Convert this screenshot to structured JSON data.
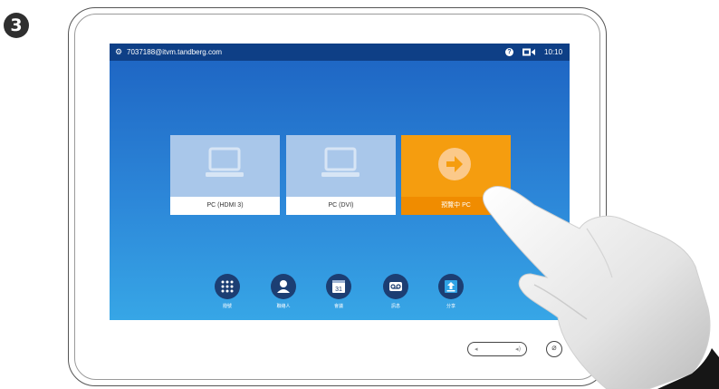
{
  "step": {
    "number": "3"
  },
  "topbar": {
    "address": "7037188@itvm.tandberg.com",
    "help_symbol": "?",
    "time": "10:10",
    "bar_color": "#0e3f86"
  },
  "sources": [
    {
      "label": "PC (HDMI 3)",
      "icon": "laptop-icon",
      "state": "idle"
    },
    {
      "label": "PC (DVI)",
      "icon": "laptop-icon",
      "state": "idle"
    },
    {
      "label": "預覽中 PC",
      "icon": "arrow-right-circle-icon",
      "state": "active"
    }
  ],
  "dock": [
    {
      "label": "撥號",
      "icon": "keypad-icon"
    },
    {
      "label": "聯絡人",
      "icon": "person-icon"
    },
    {
      "label": "會議",
      "icon": "calendar-icon",
      "calendar_day": "31"
    },
    {
      "label": "訊息",
      "icon": "voicemail-icon"
    },
    {
      "label": "分享",
      "icon": "share-upload-icon"
    }
  ],
  "colors": {
    "screen_top": "#1d63c2",
    "screen_bottom": "#37a6e6",
    "active_tile": "#f59d0f",
    "dock_button": "#1c3e73"
  }
}
